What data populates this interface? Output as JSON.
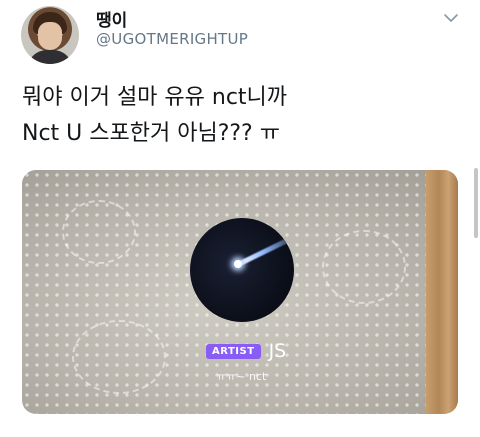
{
  "user": {
    "display_name": "땡이",
    "handle": "@UGOTMERIGHTUP"
  },
  "tweet": {
    "lines": [
      "뭐야 이거 설마 유유 nct니까",
      "Nct U 스포한거 아님??? ㅠ"
    ]
  },
  "media": {
    "badge": "ARTIST",
    "artist_name": "JS",
    "caption": "ㅠㅠ~ nct"
  },
  "icons": {
    "menu": "chevron-down-icon"
  }
}
